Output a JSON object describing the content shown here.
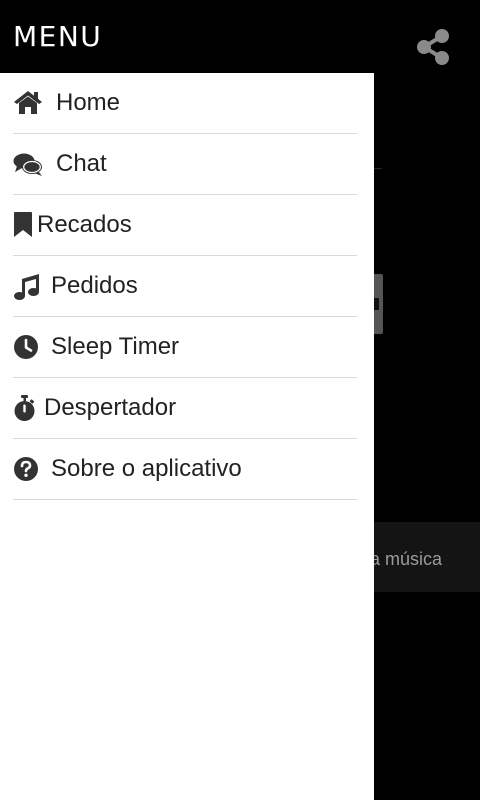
{
  "header": {
    "title": "MENU",
    "share_icon": "share-icon"
  },
  "menu": {
    "items": [
      {
        "label": "Home",
        "icon": "home-icon"
      },
      {
        "label": "Chat",
        "icon": "chat-icon"
      },
      {
        "label": "Recados",
        "icon": "bookmark-icon"
      },
      {
        "label": "Pedidos",
        "icon": "music-note-icon"
      },
      {
        "label": "Sleep Timer",
        "icon": "clock-icon"
      },
      {
        "label": "Despertador",
        "icon": "stopwatch-icon"
      },
      {
        "label": "Sobre o aplicativo",
        "icon": "help-circle-icon"
      }
    ]
  },
  "background": {
    "bar_text": "a música"
  },
  "colors": {
    "header_bg": "#000000",
    "drawer_bg": "#ffffff",
    "text": "#222222",
    "divider": "#d9d9d9",
    "icon": "#333333"
  }
}
